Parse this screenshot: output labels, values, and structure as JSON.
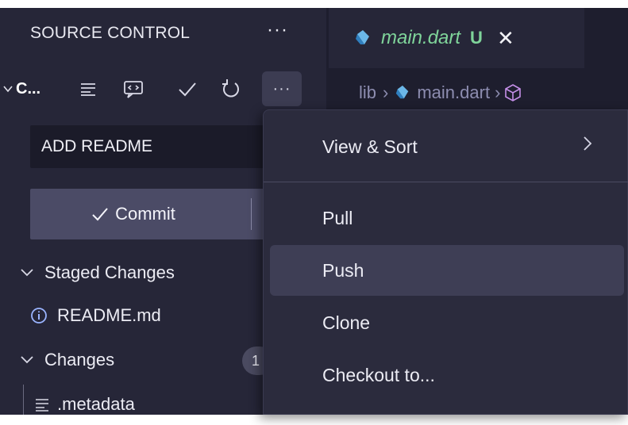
{
  "source_control": {
    "title": "SOURCE CONTROL",
    "more": "···",
    "repo_label": "C...",
    "toolbar_more": "···"
  },
  "commit": {
    "message_value": "ADD README",
    "commit_label": "Commit"
  },
  "tree": {
    "staged_header": "Staged Changes",
    "staged_file": "README.md",
    "changes_header": "Changes",
    "changes_count": "1",
    "changes_file": ".metadata"
  },
  "editor": {
    "tab_name": "main.dart",
    "tab_status": "U",
    "breadcrumb": [
      "lib",
      "main.dart"
    ]
  },
  "menu": {
    "items": [
      {
        "label": "View & Sort",
        "has_submenu": true
      },
      {
        "label": "Pull"
      },
      {
        "label": "Push"
      },
      {
        "label": "Clone"
      },
      {
        "label": "Checkout to..."
      }
    ]
  },
  "colors": {
    "sidebar_bg": "#262638",
    "editor_bg": "#1e1e2e",
    "menu_bg": "#2b2b3d",
    "accent_green": "#7fd49a",
    "commit_button": "#4b4b66"
  }
}
